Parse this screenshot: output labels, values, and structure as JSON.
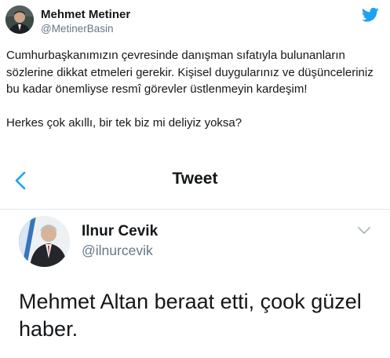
{
  "tweet": {
    "author_name": "Mehmet Metiner",
    "author_handle": "@MetinerBasin",
    "icons": {
      "brand": "twitter-bird-icon"
    },
    "colors": {
      "brand": "#1da1f2",
      "text": "#14171a",
      "muted": "#657786"
    },
    "text_paragraphs": [
      "Cumhurbaşkanımızın çevresinde danışman sıfatıyla bulunanların sözlerine dikkat etmeleri gerekir. Kişisel duygularınız ve düşünceleriniz bu kadar önemliyse resmî görevler üstlenmeyin kardeşim!",
      "Herkes çok akıllı, bir tek biz mi deliyiz yoksa?"
    ]
  },
  "embedded": {
    "header_title": "Tweet",
    "icons": {
      "back": "chevron-left-icon",
      "menu": "chevron-down-icon"
    },
    "quoted_name": "Ilnur Cevik",
    "quoted_handle": "@ilnurcevik",
    "quoted_text": "Mehmet Altan beraat etti, çook güzel haber."
  }
}
